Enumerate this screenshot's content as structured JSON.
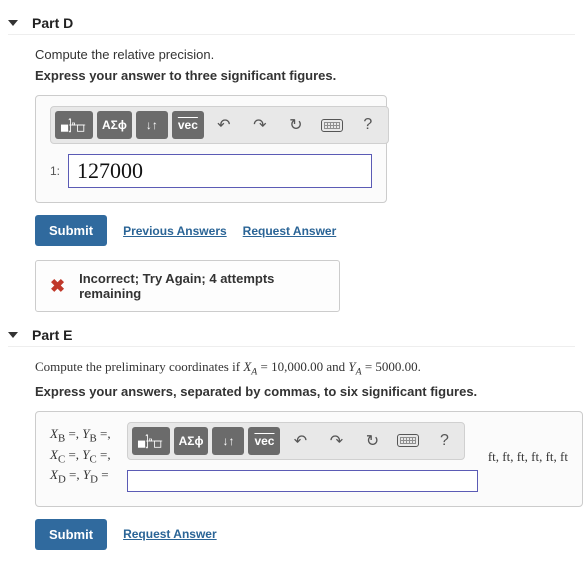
{
  "partD": {
    "title": "Part D",
    "instruction": "Compute the relative precision.",
    "format": "Express your answer to three significant figures.",
    "input_index": "1:",
    "input_value": "127000",
    "submit": "Submit",
    "prev_link": "Previous Answers",
    "req_link": "Request Answer",
    "feedback": "Incorrect; Try Again; 4 attempts remaining"
  },
  "partE": {
    "title": "Part E",
    "instruction_prefix": "Compute the preliminary coordinates if ",
    "xa_label": "X",
    "xa_sub": "A",
    "xa_val": " = 10,000.00",
    "and": " and ",
    "ya_label": "Y",
    "ya_sub": "A",
    "ya_val": " = 5000.00",
    "period": ".",
    "format": "Express your answers, separated by commas, to six significant figures.",
    "labels_line1_a": "X",
    "labels_line1_as": "B",
    "labels_eq": " =, ",
    "labels_line1_b": "Y",
    "labels_line1_bs": "B",
    "labels_eqc": " =,",
    "labels_line2_a": "X",
    "labels_line2_as": "C",
    "labels_line2_b": "Y",
    "labels_line2_bs": "C",
    "labels_line3_a": "X",
    "labels_line3_as": "D",
    "labels_line3_b": "Y",
    "labels_line3_bs": "D",
    "labels_eqend": " =",
    "units": "ft, ft, ft, ft, ft, ft",
    "submit": "Submit",
    "req_link": "Request Answer"
  },
  "toolbar": {
    "templates": "tpl",
    "greek": "ΑΣϕ",
    "subsup": "↓↑",
    "vec": "vec",
    "undo": "↶",
    "redo": "↷",
    "reset": "↻",
    "keyboard": "kbd",
    "help": "?"
  }
}
